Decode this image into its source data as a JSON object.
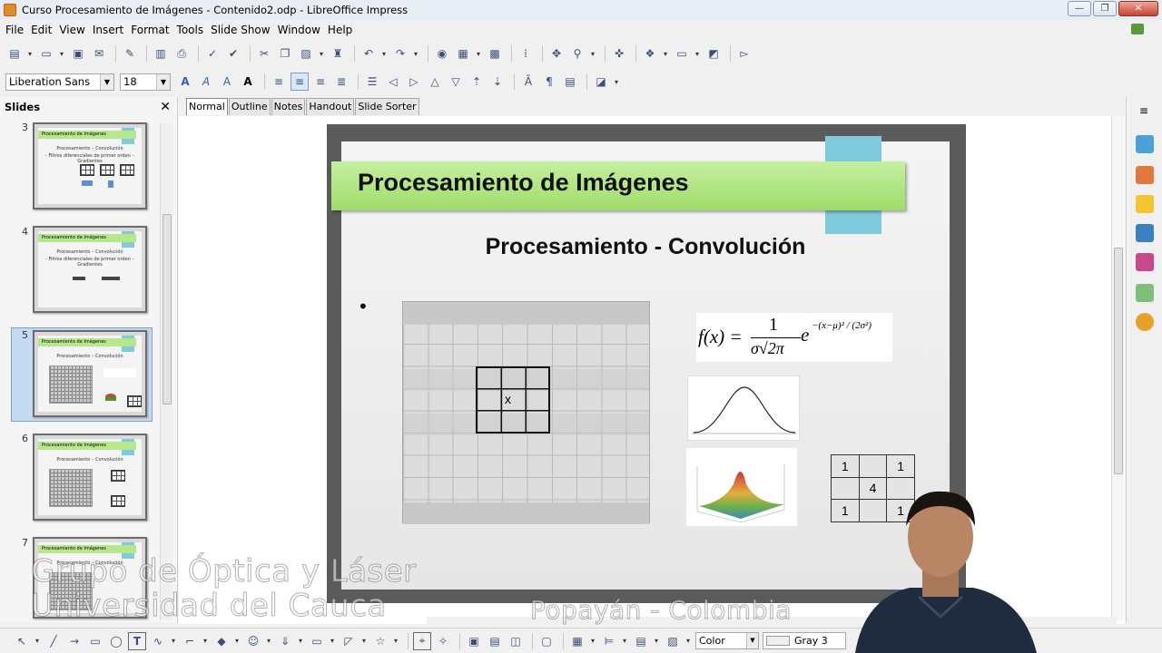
{
  "window": {
    "title": "Curso Procesamiento de Imágenes - Contenido2.odp - LibreOffice Impress",
    "minimize": "—",
    "maximize": "❐",
    "close": "✕"
  },
  "menu": [
    "File",
    "Edit",
    "View",
    "Insert",
    "Format",
    "Tools",
    "Slide Show",
    "Window",
    "Help"
  ],
  "formatting": {
    "font_name": "Liberation Sans",
    "font_size": "18"
  },
  "slides_pane": {
    "header": "Slides",
    "close": "✕",
    "slides": [
      {
        "number": "3",
        "title": "Procesamiento de Imágenes",
        "lines": [
          "Procesamiento – Convolución",
          "- Filtros diferenciales de primer orden – Gradientes"
        ]
      },
      {
        "number": "4",
        "title": "Procesamiento de Imágenes",
        "lines": [
          "Procesamiento – Convolución",
          "- Filtros diferenciales de primer orden – Gradientes"
        ]
      },
      {
        "number": "5",
        "title": "Procesamiento de Imágenes",
        "lines": [
          "Procesamiento – Convolución"
        ]
      },
      {
        "number": "6",
        "title": "Procesamiento de Imágenes",
        "lines": [
          "Procesamiento – Convolución"
        ]
      },
      {
        "number": "7",
        "title": "Procesamiento de Imágenes",
        "lines": [
          "Procesamiento – Convolución"
        ]
      }
    ],
    "selected_slide": "5"
  },
  "view_tabs": [
    "Normal",
    "Outline",
    "Notes",
    "Handout",
    "Slide Sorter"
  ],
  "active_view_tab": "Normal",
  "slide": {
    "title": "Procesamiento de Imágenes",
    "subtitle": "Procesamiento - Convolución",
    "bullet": "•",
    "kernel_center_label": "x",
    "formula": {
      "lhs": "f(x) =",
      "numerator": "1",
      "denominator": "σ√2π",
      "base": "e",
      "exponent": "−(x−μ)² / (2σ²)"
    },
    "mask_table": [
      [
        "1",
        "",
        "1"
      ],
      [
        "",
        "4",
        ""
      ],
      [
        "1",
        "",
        "1"
      ]
    ],
    "colors": {
      "title_bar": "#9fdc6b",
      "accent_tab": "#7fcadb",
      "slide_frame": "#5b5b5b"
    }
  },
  "drawing_toolbar": {
    "area_style": "Color",
    "fill_color": "Gray 3"
  },
  "watermarks": {
    "group": "Grupo de Óptica y Láser",
    "university": "Universidad del Cauca",
    "location": "Popayán - Colombia"
  }
}
